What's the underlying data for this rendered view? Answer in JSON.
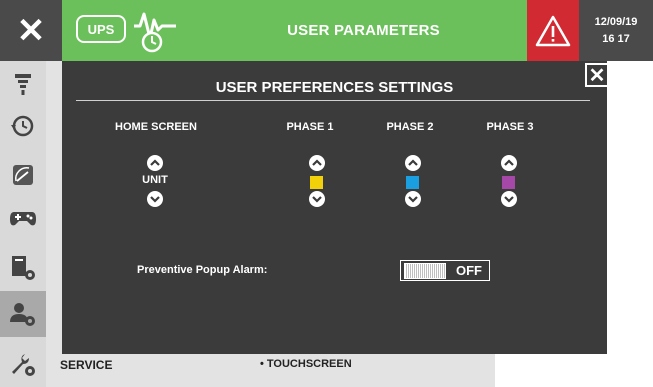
{
  "header": {
    "ups_label": "UPS",
    "title": "USER PARAMETERS",
    "date": "12/09/19",
    "time": "16 17",
    "colors": {
      "green": "#6cc05c",
      "alarm": "#d12a33",
      "dark": "#4a4a4a"
    },
    "icons": [
      "close-icon",
      "waveform-clock-icon",
      "warning-icon"
    ]
  },
  "sidebar": {
    "items": [
      {
        "icon": "meter-icon"
      },
      {
        "icon": "history-icon"
      },
      {
        "icon": "gauge-icon"
      },
      {
        "icon": "gamepad-icon"
      },
      {
        "icon": "device-settings-icon"
      },
      {
        "icon": "user-settings-icon",
        "active": true
      },
      {
        "icon": "wrench-gear-icon"
      }
    ]
  },
  "background": {
    "service_label": "SERVICE",
    "touchscreen_label": "• TOUCHSCREEN"
  },
  "modal": {
    "title": "USER PREFERENCES SETTINGS",
    "columns": {
      "home": "HOME SCREEN",
      "phase1": "PHASE 1",
      "phase2": "PHASE 2",
      "phase3": "PHASE 3"
    },
    "home_value": "UNIT",
    "phase_colors": {
      "phase1": "#f2d10a",
      "phase2": "#1aa0e0",
      "phase3": "#a548a8"
    },
    "popup_label": "Preventive Popup Alarm:",
    "toggle_state": "OFF"
  }
}
